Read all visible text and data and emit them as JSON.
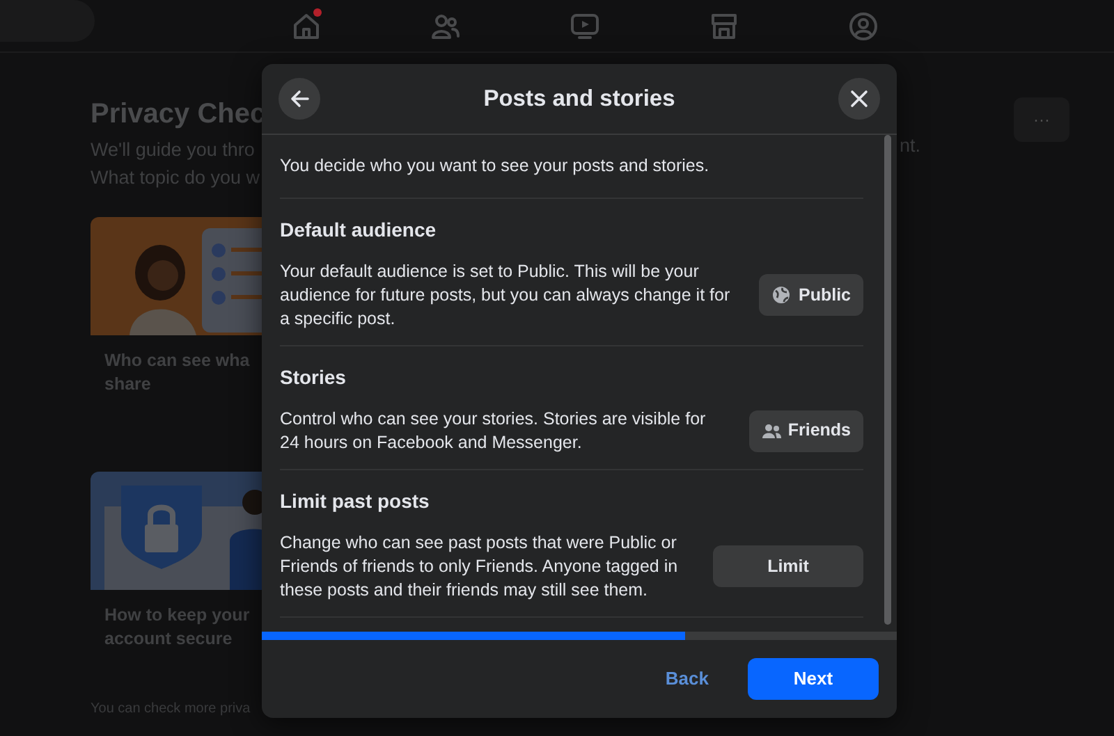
{
  "top_nav": {
    "items": [
      {
        "kind": "home",
        "notification": true
      },
      {
        "kind": "friends",
        "notification": false
      },
      {
        "kind": "video",
        "notification": false
      },
      {
        "kind": "marketplace",
        "notification": false
      },
      {
        "kind": "groups",
        "notification": false
      }
    ]
  },
  "background": {
    "title": "Privacy Chec",
    "intro_lines": [
      "We'll guide you thro",
      "What topic do you w"
    ],
    "intro_tail": "nt.",
    "more_button": "···",
    "topics": [
      {
        "title_lines": [
          "Who can see wha",
          "share"
        ]
      },
      {
        "title_lines": [
          "How to keep your",
          "account secure"
        ]
      }
    ],
    "footer": "You can check more priva"
  },
  "dialog": {
    "title": "Posts and stories",
    "intro": "You decide who you want to see your posts and stories.",
    "sections": [
      {
        "heading": "Default audience",
        "text": "Your default audience is set to Public. This will be your audience for future posts, but you can always change it for a specific post.",
        "button": {
          "kind": "globe",
          "label": "Public"
        }
      },
      {
        "heading": "Stories",
        "text": "Control who can see your stories. Stories are visible for 24 hours on Facebook and Messenger.",
        "button": {
          "kind": "people",
          "label": "Friends"
        }
      },
      {
        "heading": "Limit past posts",
        "text": "Change who can see past posts that were Public or Friends of friends to only Friends. Anyone tagged in these posts and their friends may still see them.",
        "button": {
          "kind": "wide",
          "label": "Limit"
        }
      }
    ],
    "progress": {
      "level": 0.667
    },
    "back": "Back",
    "next": "Next"
  }
}
